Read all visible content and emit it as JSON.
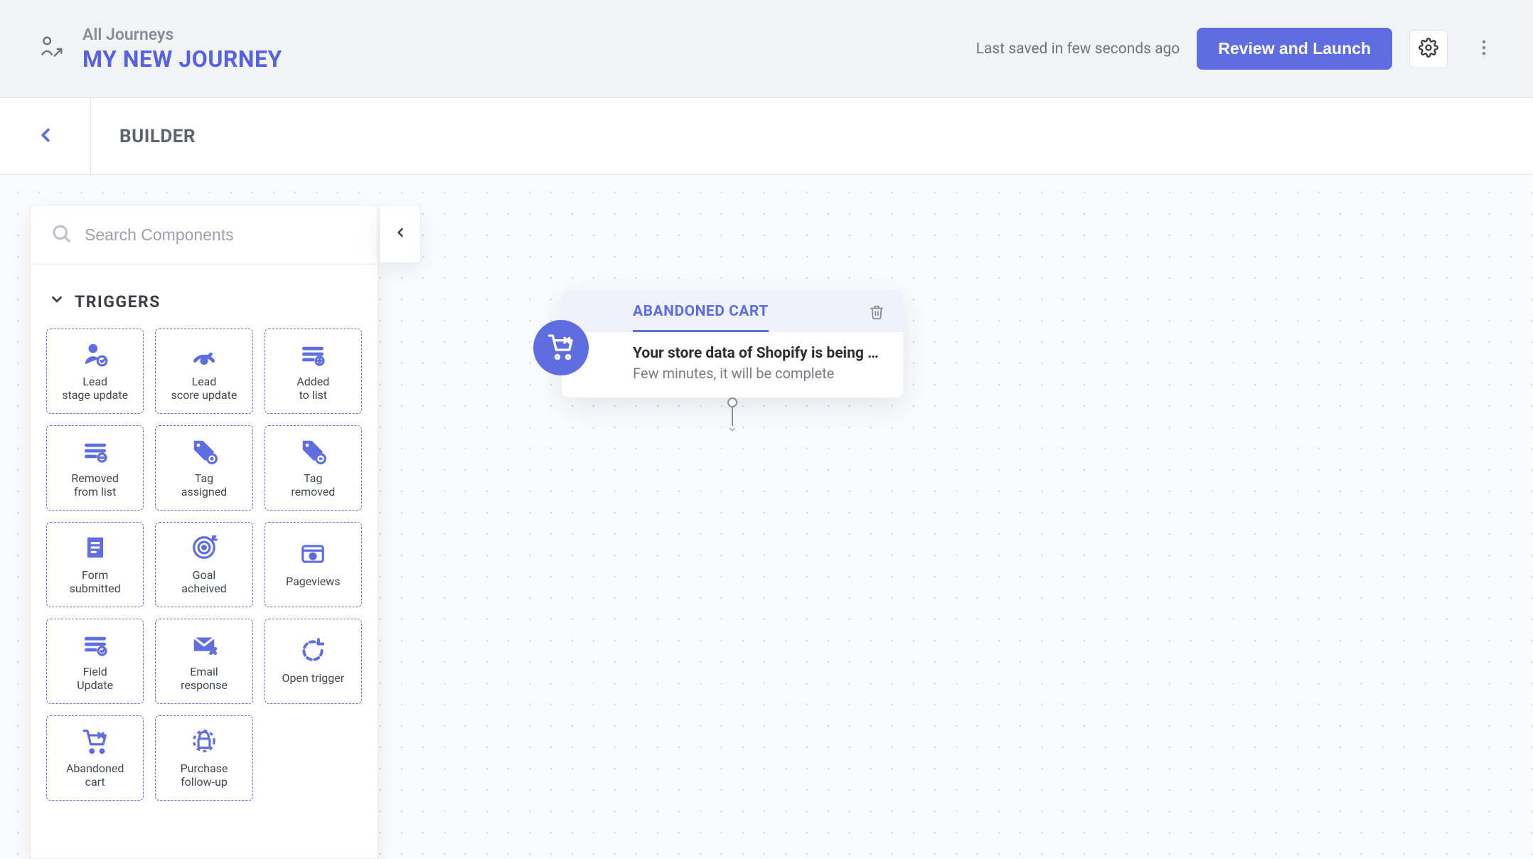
{
  "breadcrumb": {
    "parent": "All Journeys",
    "title": "MY NEW JOURNEY"
  },
  "topbar": {
    "last_saved": "Last saved in few seconds ago",
    "review_button": "Review and Launch"
  },
  "subbar": {
    "title": "BUILDER"
  },
  "search": {
    "placeholder": "Search Components"
  },
  "triggers_section": {
    "heading": "TRIGGERS",
    "items": [
      {
        "id": "lead-stage-update",
        "label": "Lead\nstage update"
      },
      {
        "id": "lead-score-update",
        "label": "Lead\nscore update"
      },
      {
        "id": "added-to-list",
        "label": "Added\nto list"
      },
      {
        "id": "removed-from-list",
        "label": "Removed\nfrom list"
      },
      {
        "id": "tag-assigned",
        "label": "Tag\nassigned"
      },
      {
        "id": "tag-removed",
        "label": "Tag\nremoved"
      },
      {
        "id": "form-submitted",
        "label": "Form\nsubmitted"
      },
      {
        "id": "goal-acheived",
        "label": "Goal\nacheived"
      },
      {
        "id": "pageviews",
        "label": "Pageviews"
      },
      {
        "id": "field-update",
        "label": "Field\nUpdate"
      },
      {
        "id": "email-response",
        "label": "Email\nresponse"
      },
      {
        "id": "open-trigger",
        "label": "Open trigger"
      },
      {
        "id": "abandoned-cart",
        "label": "Abandoned\ncart"
      },
      {
        "id": "purchase-follow-up",
        "label": "Purchase\nfollow-up"
      }
    ]
  },
  "canvas_node": {
    "title": "ABANDONED CART",
    "line1": "Your store data of Shopify is being synce…",
    "line2": "Few minutes, it will be complete"
  },
  "colors": {
    "accent": "#5e6ee1"
  }
}
